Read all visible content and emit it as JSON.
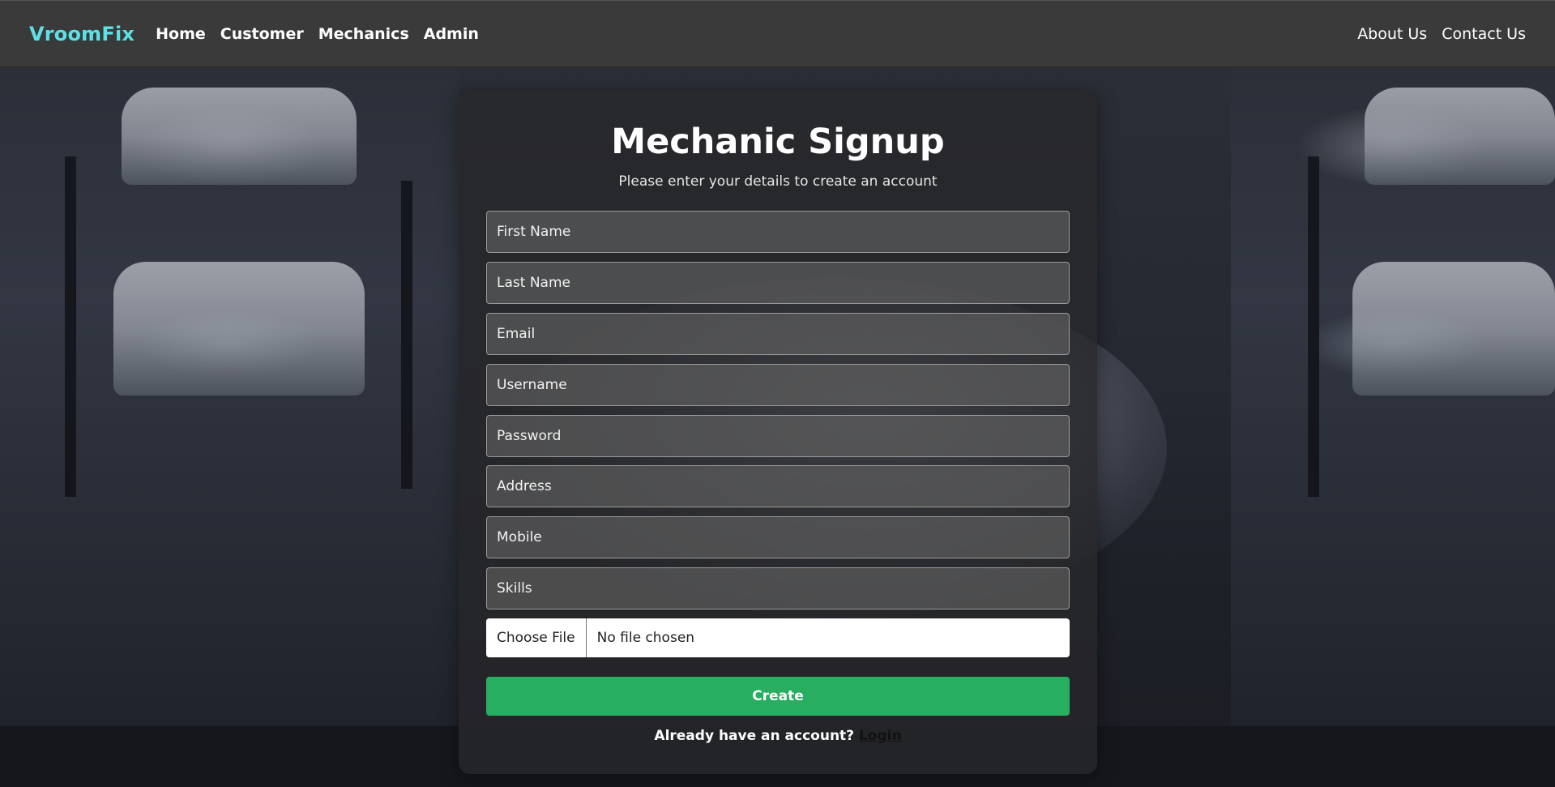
{
  "nav": {
    "brand": "VroomFix",
    "left_links": [
      "Home",
      "Customer",
      "Mechanics",
      "Admin"
    ],
    "right_links": [
      "About Us",
      "Contact Us"
    ]
  },
  "form": {
    "title": "Mechanic Signup",
    "subtitle": "Please enter your details to create an account",
    "placeholders": {
      "first_name": "First Name",
      "last_name": "Last Name",
      "email": "Email",
      "username": "Username",
      "password": "Password",
      "address": "Address",
      "mobile": "Mobile",
      "skills": "Skills"
    },
    "file_button_label": "Choose File",
    "file_status": "No file chosen",
    "submit_label": "Create",
    "login_prompt": "Already have an account?",
    "login_link": "Login"
  },
  "colors": {
    "brand": "#5ce1e6",
    "navbar_bg": "#3a3a3a",
    "submit_bg": "#27ae60"
  }
}
